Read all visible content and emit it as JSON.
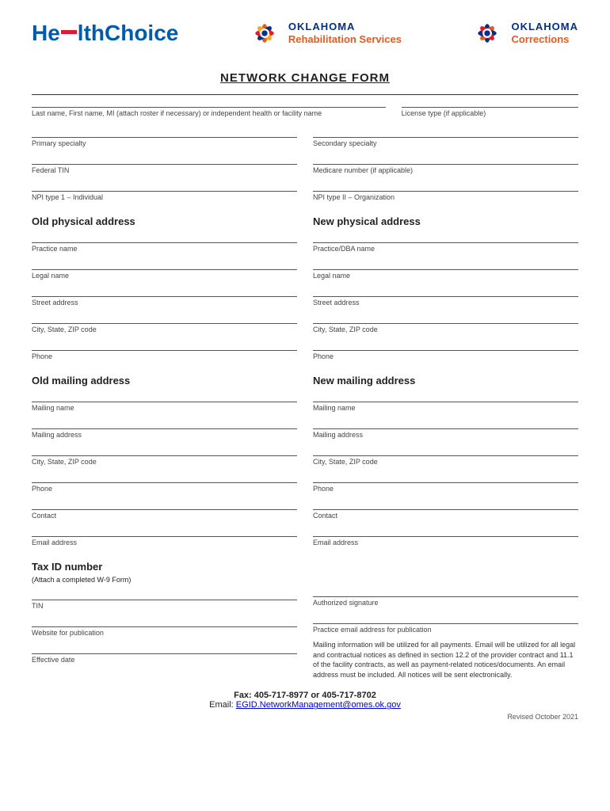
{
  "header": {
    "healthchoice": "He  lthChoice",
    "okla_rehab_state": "OKLAHOMA",
    "okla_rehab_dept": "Rehabilitation Services",
    "okla_corr_state": "OKLAHOMA",
    "okla_corr_dept": "Corrections"
  },
  "title": "NETWORK CHANGE FORM",
  "fields": {
    "name_label": "Last name, First name, MI (attach roster if necessary) or independent health or facility name",
    "license_label": "License type (if applicable)",
    "primary_specialty": "Primary specialty",
    "secondary_specialty": "Secondary specialty",
    "federal_tin": "Federal TIN",
    "medicare_number": "Medicare number (if applicable)",
    "npi_type1": "NPI type 1 – Individual",
    "npi_type2": "NPI type II – Organization"
  },
  "old_physical": {
    "title": "Old physical address",
    "practice_name": "Practice name",
    "legal_name": "Legal name",
    "street_address": "Street address",
    "city_state_zip": "City, State, ZIP code",
    "phone": "Phone"
  },
  "new_physical": {
    "title": "New physical address",
    "practice_name": "Practice/DBA name",
    "legal_name": "Legal name",
    "street_address": "Street address",
    "city_state_zip": "City, State, ZIP code",
    "phone": "Phone"
  },
  "old_mailing": {
    "title": "Old mailing address",
    "mailing_name": "Mailing name",
    "mailing_address": "Mailing address",
    "city_state_zip": "City, State, ZIP code",
    "phone": "Phone",
    "contact": "Contact",
    "email": "Email address"
  },
  "new_mailing": {
    "title": "New mailing address",
    "mailing_name": "Mailing name",
    "mailing_address": "Mailing address",
    "city_state_zip": "City, State, ZIP code",
    "phone": "Phone",
    "contact": "Contact",
    "email": "Email address"
  },
  "tax_id": {
    "title": "Tax ID number",
    "subtitle": "(Attach a completed W-9 Form)",
    "tin": "TIN",
    "website": "Website for publication",
    "effective_date": "Effective date"
  },
  "signature_section": {
    "authorized_signature": "Authorized signature",
    "practice_email": "Practice email address for publication",
    "notice": "Mailing information will be utilized for all payments. Email will be utilized for all legal and contractual notices as defined in section 12.2 of the provider contract and 11.1 of the facility contracts, as well as payment-related notices/documents. An email address must be included. All notices will be sent electronically."
  },
  "footer": {
    "fax": "Fax: 405-717-8977 or 405-717-8702",
    "email_label": "Email: ",
    "email_address": "EGID.NetworkManagement@omes.ok.gov",
    "revised": "Revised October 2021"
  }
}
